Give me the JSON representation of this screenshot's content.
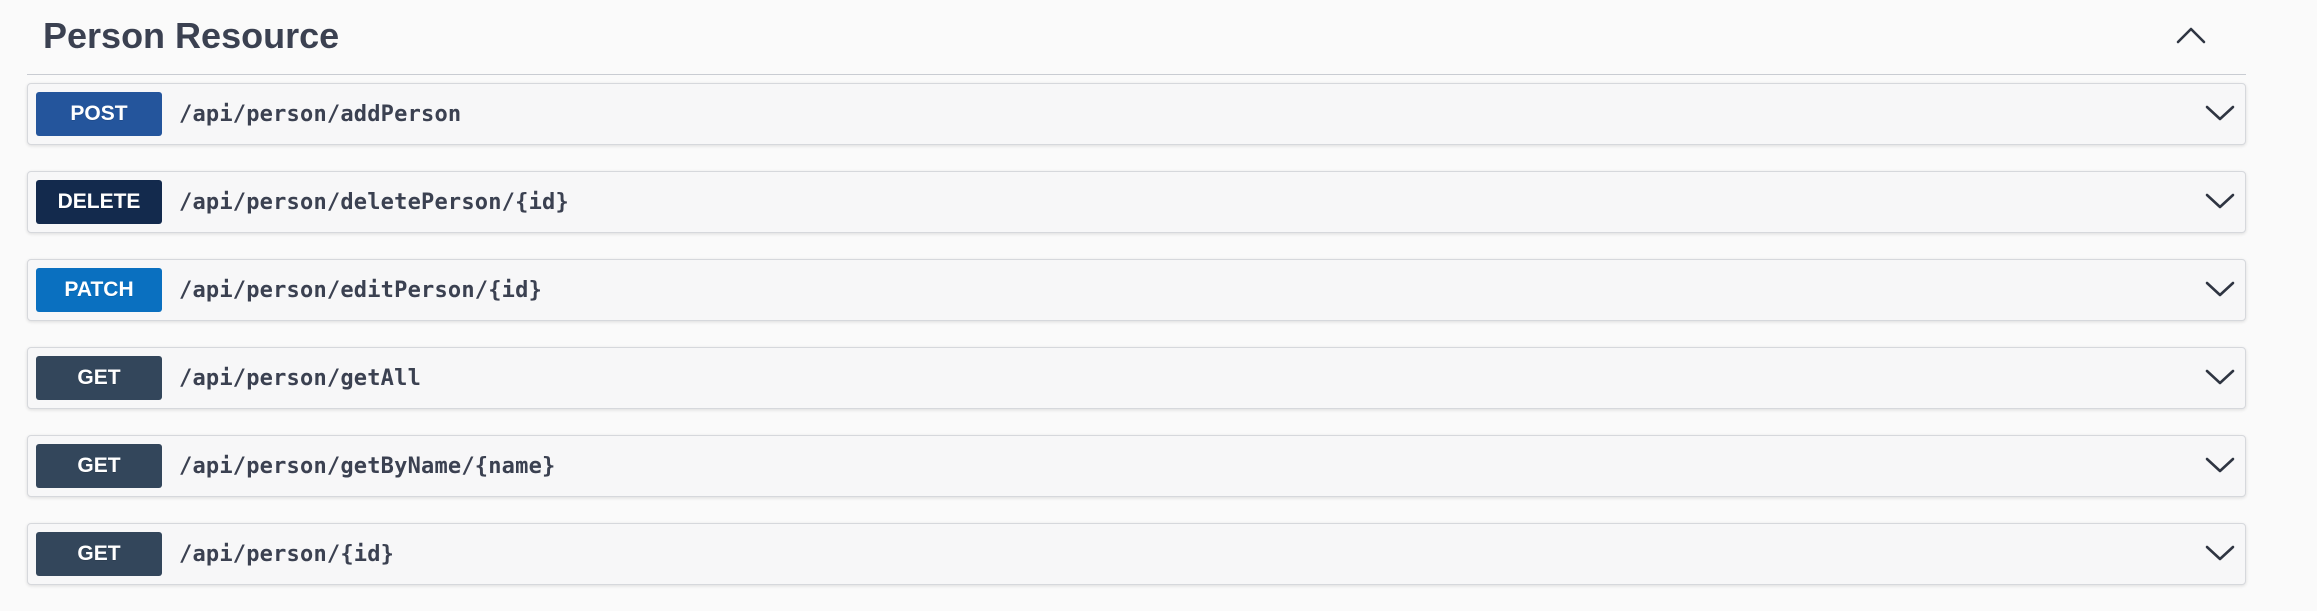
{
  "tag": {
    "title": "Person Resource",
    "toggle_icon": "chevron-up-icon"
  },
  "method_colors": {
    "POST": "#24559c",
    "DELETE": "#132a4d",
    "PATCH": "#0a70c0",
    "GET": "#33465b"
  },
  "operations": [
    {
      "method": "POST",
      "path": "/api/person/addPerson"
    },
    {
      "method": "DELETE",
      "path": "/api/person/deletePerson/{id}"
    },
    {
      "method": "PATCH",
      "path": "/api/person/editPerson/{id}"
    },
    {
      "method": "GET",
      "path": "/api/person/getAll"
    },
    {
      "method": "GET",
      "path": "/api/person/getByName/{name}"
    },
    {
      "method": "GET",
      "path": "/api/person/{id}"
    }
  ],
  "operation_expand_icon": "chevron-down-icon"
}
